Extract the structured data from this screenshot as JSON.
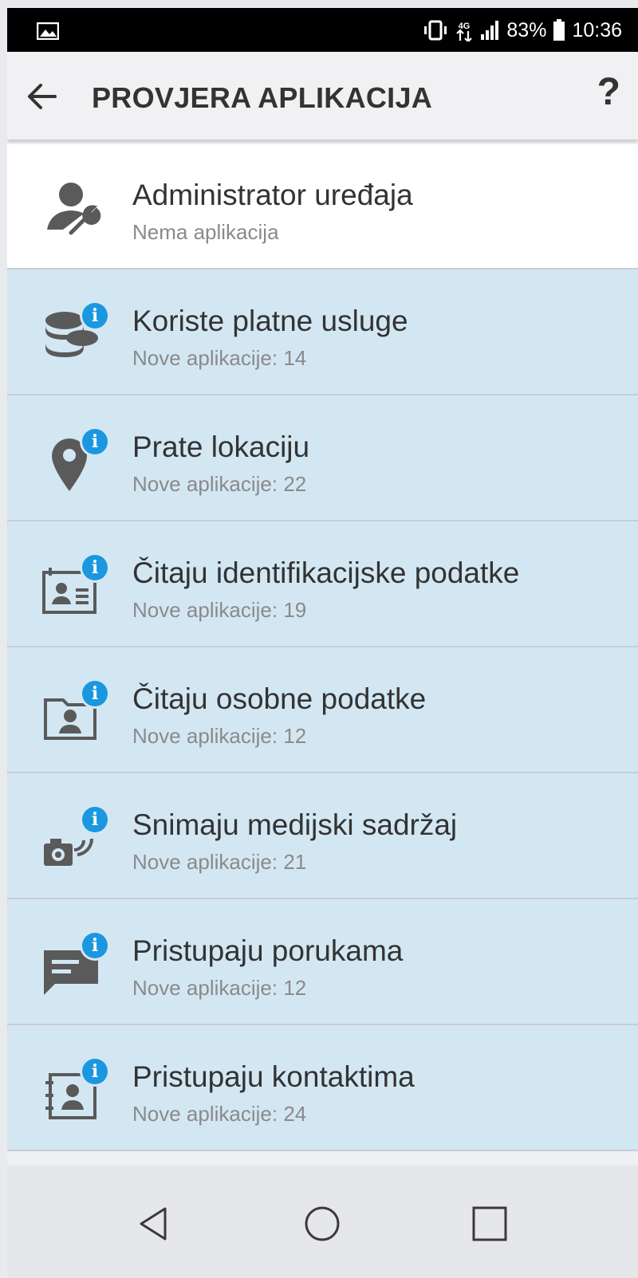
{
  "status_bar": {
    "network": "4G",
    "battery": "83%",
    "time": "10:36"
  },
  "toolbar": {
    "title": "PROVJERA APLIKACIJA",
    "help_label": "?"
  },
  "items": [
    {
      "title": "Administrator uređaja",
      "subtitle": "Nema aplikacija",
      "icon": "admin-icon",
      "highlighted": false
    },
    {
      "title": "Koriste platne usluge",
      "subtitle": "Nove aplikacije: 14",
      "icon": "coins-icon",
      "highlighted": true
    },
    {
      "title": "Prate lokaciju",
      "subtitle": "Nove aplikacije: 22",
      "icon": "location-pin-icon",
      "highlighted": true
    },
    {
      "title": "Čitaju identifikacijske podatke",
      "subtitle": "Nove aplikacije: 19",
      "icon": "id-card-icon",
      "highlighted": true
    },
    {
      "title": "Čitaju osobne podatke",
      "subtitle": "Nove aplikacije: 12",
      "icon": "personal-data-icon",
      "highlighted": true
    },
    {
      "title": "Snimaju medijski sadržaj",
      "subtitle": "Nove aplikacije: 21",
      "icon": "camera-mic-icon",
      "highlighted": true
    },
    {
      "title": "Pristupaju porukama",
      "subtitle": "Nove aplikacije: 12",
      "icon": "messages-icon",
      "highlighted": true
    },
    {
      "title": "Pristupaju kontaktima",
      "subtitle": "Nove aplikacije: 24",
      "icon": "contacts-icon",
      "highlighted": true
    }
  ],
  "badge_label": "i",
  "colors": {
    "highlight_row": "#d3e7f3",
    "badge": "#1b97e0",
    "icon": "#5a5a5a"
  }
}
